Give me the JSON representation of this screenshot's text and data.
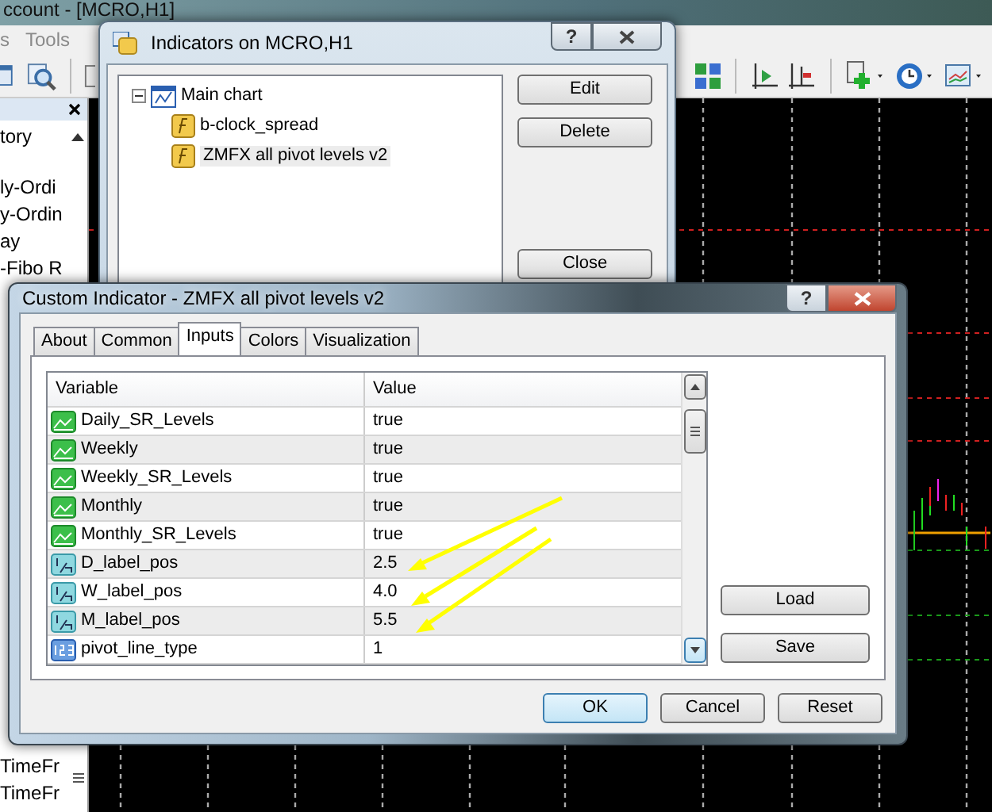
{
  "main_window": {
    "title": "ccount - [MCRO,H1]",
    "menu": [
      "s",
      "Tools"
    ],
    "navigator": {
      "items": [
        "tory",
        "ly-Ordi",
        "y-Ordin",
        "ay",
        "-Fibo R"
      ],
      "lower_items": [
        "TimeFr",
        "TimeFr"
      ]
    }
  },
  "indicators_dialog": {
    "title": "Indicators on MCRO,H1",
    "help": "?",
    "tree": {
      "label": "Main chart",
      "expanded": true,
      "children": [
        {
          "label": "b-clock_spread",
          "selected": false
        },
        {
          "label": "ZMFX all pivot levels v2",
          "selected": true
        }
      ]
    },
    "buttons": [
      "Edit",
      "Delete",
      "Close"
    ]
  },
  "custom_indicator_dialog": {
    "title": "Custom Indicator - ZMFX all pivot levels v2",
    "help": "?",
    "tabs": [
      {
        "label": "About",
        "selected": false
      },
      {
        "label": "Common",
        "selected": false
      },
      {
        "label": "Inputs",
        "selected": true
      },
      {
        "label": "Colors",
        "selected": false
      },
      {
        "label": "Visualization",
        "selected": false
      }
    ],
    "table": {
      "columns": [
        "Variable",
        "Value"
      ],
      "rows": [
        {
          "kind": "bool",
          "variable": "Daily_SR_Levels",
          "value": "true"
        },
        {
          "kind": "bool",
          "variable": "Weekly",
          "value": "true"
        },
        {
          "kind": "bool",
          "variable": "Weekly_SR_Levels",
          "value": "true"
        },
        {
          "kind": "bool",
          "variable": "Monthly",
          "value": "true"
        },
        {
          "kind": "bool",
          "variable": "Monthly_SR_Levels",
          "value": "true"
        },
        {
          "kind": "double",
          "variable": "D_label_pos",
          "value": "2.5"
        },
        {
          "kind": "double",
          "variable": "W_label_pos",
          "value": "4.0"
        },
        {
          "kind": "double",
          "variable": "M_label_pos",
          "value": "5.5"
        },
        {
          "kind": "int",
          "variable": "pivot_line_type",
          "value": "1"
        }
      ]
    },
    "side_buttons": [
      "Load",
      "Save"
    ],
    "buttons": [
      {
        "label": "OK",
        "default": true
      },
      {
        "label": "Cancel",
        "default": false
      },
      {
        "label": "Reset",
        "default": false
      }
    ]
  }
}
